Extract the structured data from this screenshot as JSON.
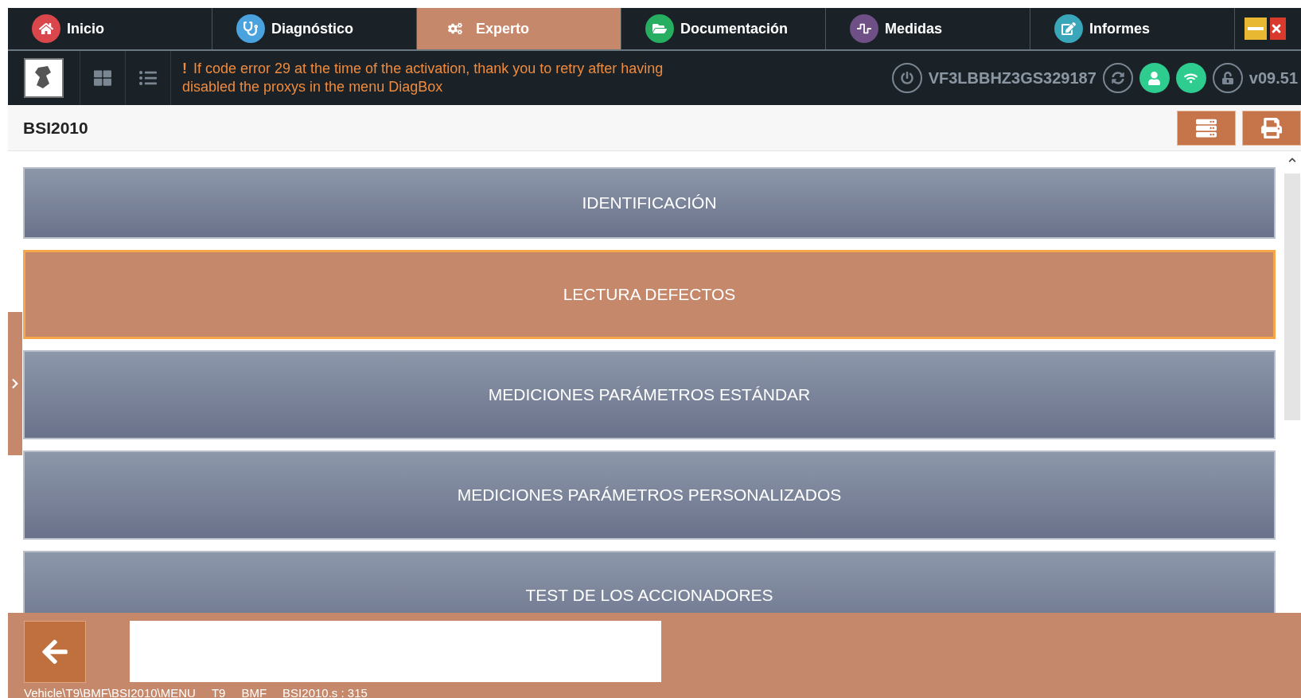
{
  "tabs": [
    {
      "label": "Inicio",
      "selected": false,
      "color": "#d9464b"
    },
    {
      "label": "Diagnóstico",
      "selected": false,
      "color": "#4aa3df"
    },
    {
      "label": "Experto",
      "selected": true
    },
    {
      "label": "Documentación",
      "selected": false,
      "color": "#27ae60"
    },
    {
      "label": "Medidas",
      "selected": false,
      "color": "#6e4f86"
    },
    {
      "label": "Informes",
      "selected": false,
      "color": "#3aa6b9"
    }
  ],
  "notice": {
    "mark": "!",
    "message": "If code error 29 at the time of the activation, thank you to retry after having disabled the proxys in the menu DiagBox"
  },
  "vehicle": {
    "vin": "VF3LBBHZ3GS329187",
    "version": "v09.51"
  },
  "page_title": "BSI2010",
  "menu_items": [
    {
      "label": "IDENTIFICACIÓN",
      "selected": false
    },
    {
      "label": "LECTURA DEFECTOS",
      "selected": true
    },
    {
      "label": "MEDICIONES PARÁMETROS ESTÁNDAR",
      "selected": false
    },
    {
      "label": "MEDICIONES PARÁMETROS PERSONALIZADOS",
      "selected": false
    },
    {
      "label": "TEST DE LOS ACCIONADORES",
      "selected": false
    }
  ],
  "footer": {
    "path": [
      "Vehicle\\T9\\BMF\\BSI2010\\MENU",
      "T9",
      "BMF",
      "BSI2010.s : 315"
    ]
  }
}
